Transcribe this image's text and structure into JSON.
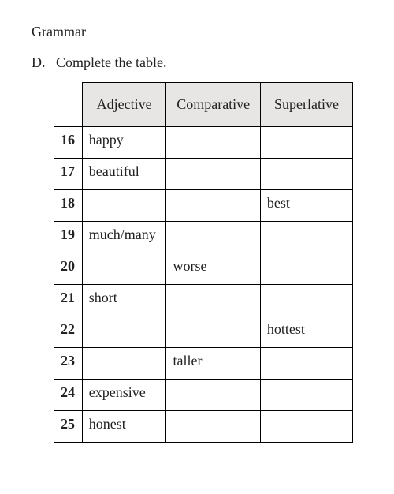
{
  "section_title": "Grammar",
  "instruction_label": "D.",
  "instruction_text": "Complete the table.",
  "headers": {
    "adjective": "Adjective",
    "comparative": "Comparative",
    "superlative": "Superlative"
  },
  "rows": [
    {
      "num": "16",
      "adjective": "happy",
      "comparative": "",
      "superlative": ""
    },
    {
      "num": "17",
      "adjective": "beautiful",
      "comparative": "",
      "superlative": ""
    },
    {
      "num": "18",
      "adjective": "",
      "comparative": "",
      "superlative": "best"
    },
    {
      "num": "19",
      "adjective": "much/many",
      "comparative": "",
      "superlative": ""
    },
    {
      "num": "20",
      "adjective": "",
      "comparative": "worse",
      "superlative": ""
    },
    {
      "num": "21",
      "adjective": "short",
      "comparative": "",
      "superlative": ""
    },
    {
      "num": "22",
      "adjective": "",
      "comparative": "",
      "superlative": "hottest"
    },
    {
      "num": "23",
      "adjective": "",
      "comparative": "taller",
      "superlative": ""
    },
    {
      "num": "24",
      "adjective": "expensive",
      "comparative": "",
      "superlative": ""
    },
    {
      "num": "25",
      "adjective": "honest",
      "comparative": "",
      "superlative": ""
    }
  ]
}
